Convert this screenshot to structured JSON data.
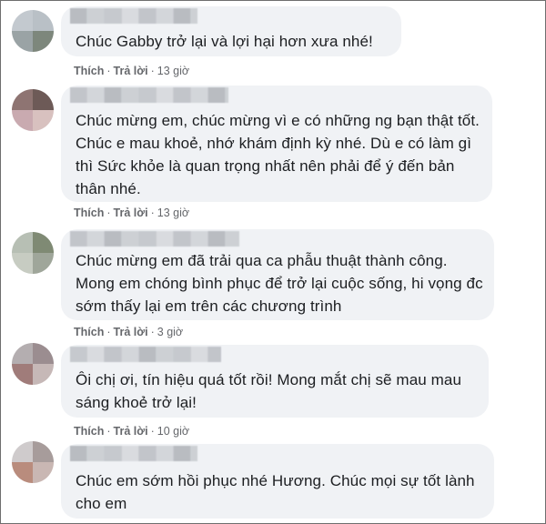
{
  "comments": [
    {
      "text": "Chúc Gabby trở lại và lợi hại hơn xưa nhé!",
      "like": "Thích",
      "reply": "Trả lời",
      "time": "13 giờ",
      "avatar_colors": [
        "#c3c9cf",
        "#b9c0c6",
        "#9aa3a5",
        "#7d877c"
      ]
    },
    {
      "text": "Chúc mừng em, chúc mừng vì e có những ng bạn thật tốt. Chúc e mau khoẻ, nhớ khám định kỳ nhé. Dù e có làm gì thì Sức khỏe là quan trọng nhất nên phải để ý đến bản thân nhé.",
      "like": "Thích",
      "reply": "Trả lời",
      "time": "13 giờ",
      "avatar_colors": [
        "#8e7472",
        "#6d5a57",
        "#c9aab0",
        "#d8c1bf"
      ]
    },
    {
      "text": "Chúc mừng em đã trải qua ca phẫu thuật thành công. Mong em chóng bình phục để trở lại cuộc sống, hi vọng đc sớm thấy lại em trên các chương trình",
      "like": "Thích",
      "reply": "Trả lời",
      "time": "3 giờ",
      "avatar_colors": [
        "#b7bfb4",
        "#7f8a74",
        "#c7ccc2",
        "#9fa69a"
      ]
    },
    {
      "text": "Ôi chị ơi, tín hiệu quá tốt rồi! Mong mắt chị sẽ mau mau sáng khoẻ trở lại!",
      "like": "Thích",
      "reply": "Trả lời",
      "time": "10 giờ",
      "avatar_colors": [
        "#b4aeb0",
        "#9b8d90",
        "#a07c7a",
        "#c6b8b7"
      ]
    },
    {
      "text": "Chúc em sớm hồi phục nhé Hương. Chúc mọi sự tốt lành cho em",
      "like": "Thích",
      "reply": "Trả lời",
      "time": "",
      "avatar_colors": [
        "#cfcbcc",
        "#a79c9b",
        "#b98c7d",
        "#c9b7b3"
      ]
    }
  ]
}
